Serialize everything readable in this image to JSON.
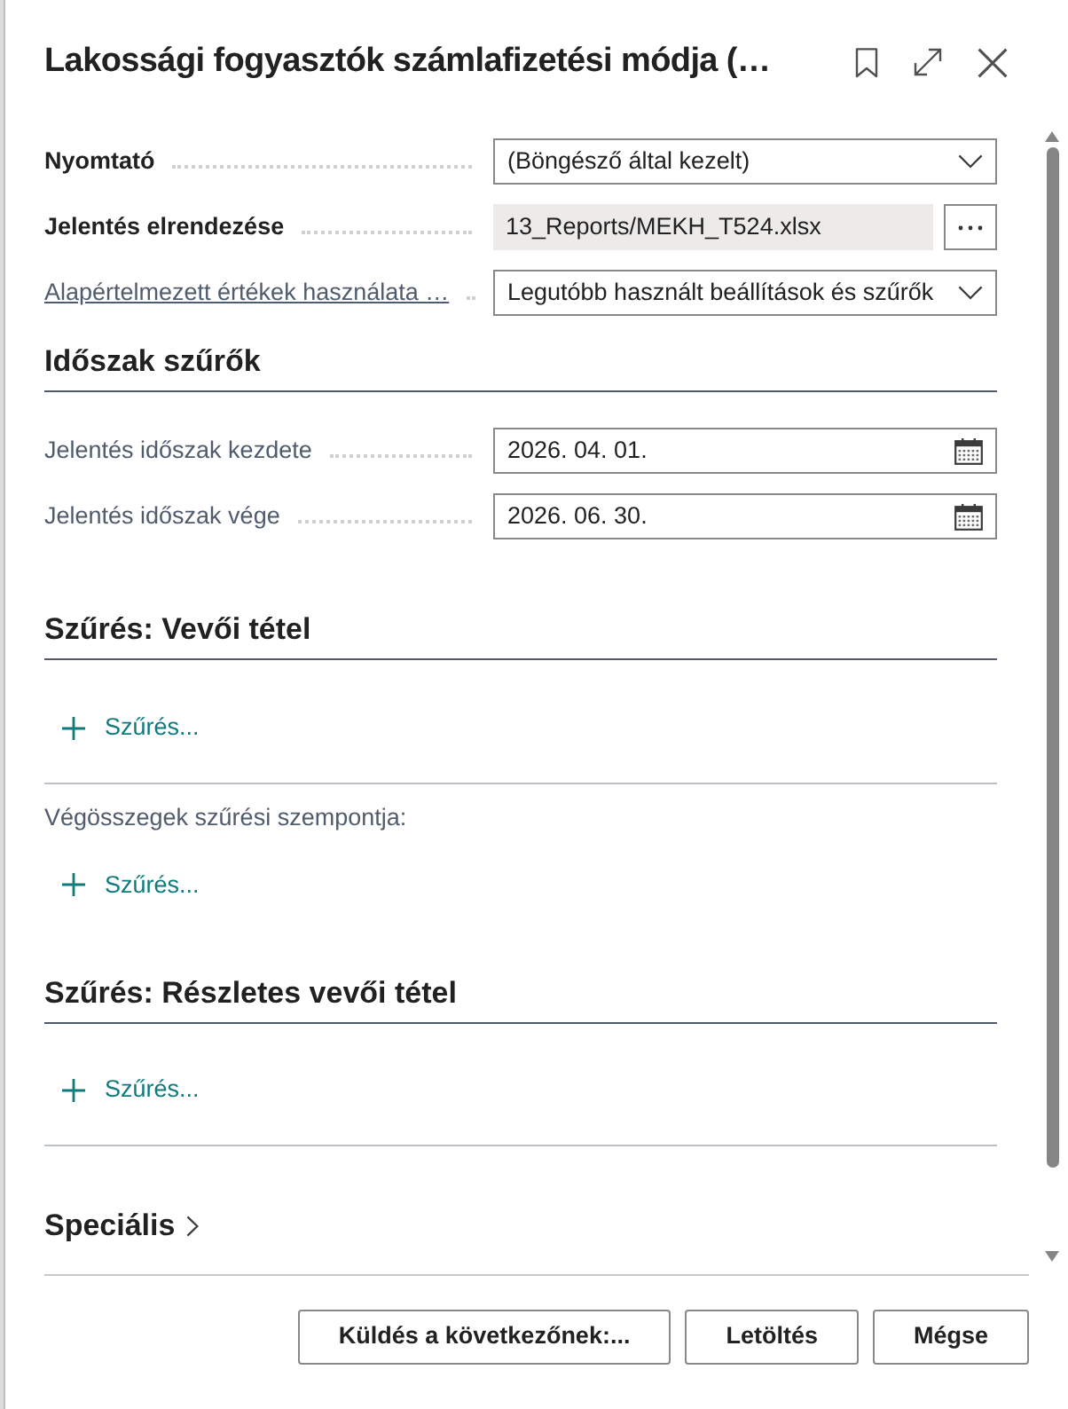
{
  "dialog": {
    "title": "Lakossági fogyasztók számlafizetési módja (…"
  },
  "options": [
    {
      "label": "Nyomtató",
      "emphasized": true,
      "link": false,
      "kind": "select",
      "value": "(Böngésző által kezelt)"
    },
    {
      "label": "Jelentés elrendezése",
      "emphasized": true,
      "link": false,
      "kind": "lookup",
      "value": "13_Reports/MEKH_T524.xlsx"
    },
    {
      "label": "Alapértelmezett értékek használata …",
      "emphasized": false,
      "link": true,
      "kind": "select",
      "value": "Legutóbb használt beállítások és szűrők"
    }
  ],
  "sections": [
    {
      "title": "Időszak szűrők",
      "kind": "fields",
      "fields": [
        {
          "label": "Jelentés időszak kezdete",
          "emphasized": false,
          "link": false,
          "kind": "date",
          "value": "2026. 04. 01."
        },
        {
          "label": "Jelentés időszak vége",
          "emphasized": false,
          "link": false,
          "kind": "date",
          "value": "2026. 06. 30."
        }
      ]
    },
    {
      "title": "Szűrés: Vevői tétel",
      "kind": "filters",
      "groups": [
        {
          "add_filter": "Szűrés..."
        },
        {
          "caption": "Végösszegek szűrési szempontja:",
          "add_filter": "Szűrés..."
        }
      ]
    },
    {
      "title": "Szűrés: Részletes vevői tétel",
      "kind": "filters",
      "groups": [
        {
          "add_filter": "Szűrés..."
        }
      ]
    },
    {
      "title": "Speciális",
      "kind": "collapsed"
    }
  ],
  "buttons": [
    "Küldés a következőnek:...",
    "Letöltés",
    "Mégse"
  ]
}
